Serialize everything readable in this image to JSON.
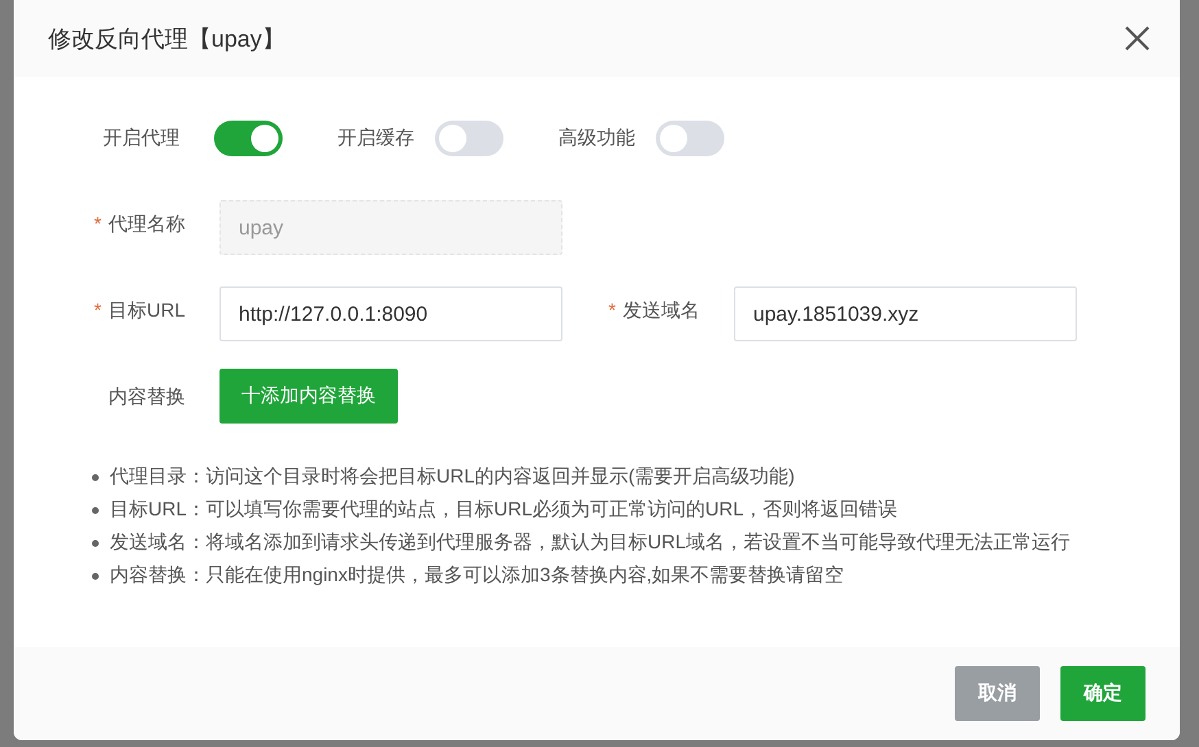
{
  "dialog": {
    "title": "修改反向代理【upay】",
    "switches": [
      {
        "label": "开启代理",
        "on": true
      },
      {
        "label": "开启缓存",
        "on": false
      },
      {
        "label": "高级功能",
        "on": false
      }
    ],
    "name_field": {
      "label": "代理名称",
      "required_mark": "*",
      "value": "upay",
      "disabled": true
    },
    "url_row": [
      {
        "label": "目标URL",
        "required_mark": "*",
        "value": "http://127.0.0.1:8090",
        "disabled": false
      },
      {
        "label": "发送域名",
        "required_mark": "*",
        "value": "upay.1851039.xyz",
        "disabled": false
      }
    ],
    "replace": {
      "label": "内容替换",
      "button": "十添加内容替换"
    },
    "notes": [
      "代理目录：访问这个目录时将会把目标URL的内容返回并显示(需要开启高级功能)",
      "目标URL：可以填写你需要代理的站点，目标URL必须为可正常访问的URL，否则将返回错误",
      "发送域名：将域名添加到请求头传递到代理服务器，默认为目标URL域名，若设置不当可能导致代理无法正常运行",
      "内容替换：只能在使用nginx时提供，最多可以添加3条替换内容,如果不需要替换请留空"
    ],
    "buttons": [
      {
        "label": "取消",
        "kind": "cancel"
      },
      {
        "label": "确定",
        "kind": "confirm"
      }
    ]
  }
}
